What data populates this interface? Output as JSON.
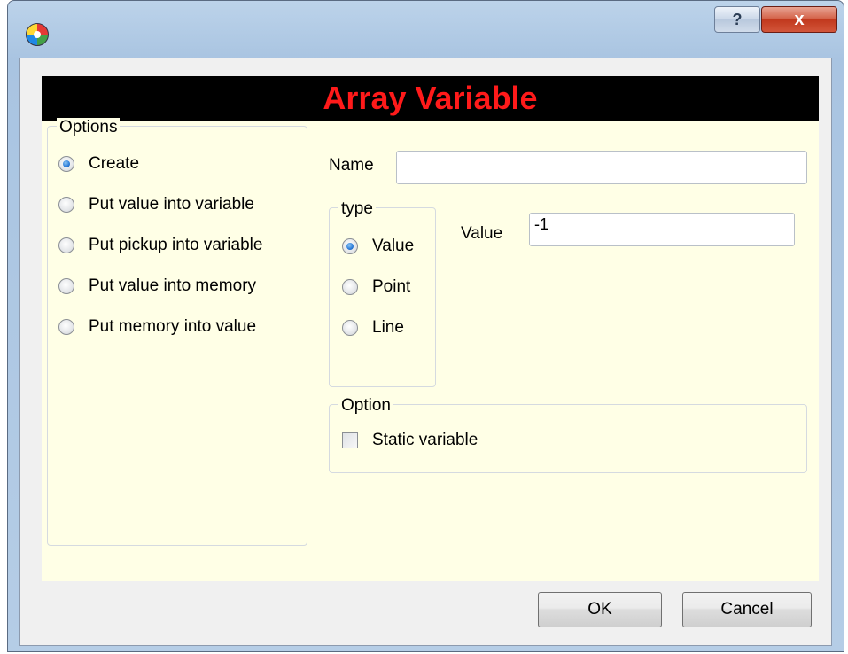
{
  "titlebar": {
    "help_glyph": "?",
    "close_glyph": "x",
    "app_icon": "app-logo-icon"
  },
  "banner": {
    "title": "Array Variable"
  },
  "options_group": {
    "legend": "Options",
    "selected": "Create",
    "items": [
      {
        "label": "Create",
        "checked": true
      },
      {
        "label": "Put value into variable",
        "checked": false
      },
      {
        "label": "Put pickup into variable",
        "checked": false
      },
      {
        "label": "Put value into memory",
        "checked": false
      },
      {
        "label": "Put memory into value",
        "checked": false
      }
    ]
  },
  "name_field": {
    "label": "Name",
    "value": ""
  },
  "type_group": {
    "legend": "type",
    "selected": "Value",
    "items": [
      {
        "label": "Value",
        "checked": true
      },
      {
        "label": "Point",
        "checked": false
      },
      {
        "label": "Line",
        "checked": false
      }
    ]
  },
  "value_field": {
    "label": "Value",
    "value": "-1"
  },
  "option_group": {
    "legend": "Option",
    "static_variable": {
      "label": "Static variable",
      "checked": false
    }
  },
  "buttons": {
    "ok": "OK",
    "cancel": "Cancel"
  },
  "colors": {
    "banner_bg": "#000000",
    "banner_text": "#ff1a1a",
    "panel_bg": "#ffffe6",
    "client_bg": "#f0f0f0"
  }
}
